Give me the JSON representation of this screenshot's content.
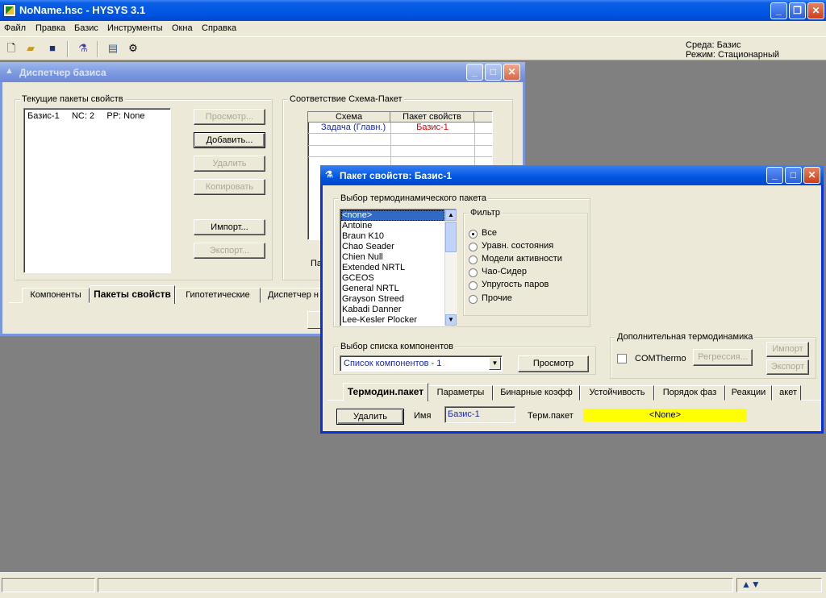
{
  "app": {
    "title": "NoName.hsc - HYSYS 3.1"
  },
  "menu": [
    "Файл",
    "Правка",
    "Базис",
    "Инструменты",
    "Окна",
    "Справка"
  ],
  "toolbar": {
    "icons": [
      "new-file-icon",
      "open-folder-icon",
      "save-icon",
      "flask-icon",
      "steam-table-icon",
      "component-icon"
    ],
    "env_line1": "Среда: Базис",
    "env_line2": "Режим: Стационарный"
  },
  "basis_manager": {
    "title": "Диспетчер базиса",
    "current_group": "Текущие пакеты свойств",
    "current_list": [
      "Базис-1     NC: 2     PP: None"
    ],
    "buttons": {
      "view": "Просмотр...",
      "add": "Добавить...",
      "delete": "Удалить",
      "copy": "Копировать",
      "import": "Импорт...",
      "export": "Экспорт..."
    },
    "mapping_group": "Соответствие Схема-Пакет",
    "mapping_headers": [
      "Схема",
      "Пакет свойств"
    ],
    "mapping_rows": [
      {
        "scheme": "Задача (Главн.)",
        "package": "Базис-1"
      }
    ],
    "peek_label": "Па",
    "tabs": [
      "Компоненты",
      "Пакеты свойств",
      "Гипотетические",
      "Диспетчер н"
    ]
  },
  "property_package": {
    "title": "Пакет свойств: Базис-1",
    "thermo_group": "Выбор термодинамического пакета",
    "thermo_list": [
      "<none>",
      "Antoine",
      "Braun K10",
      "Chao Seader",
      "Chien Null",
      "Extended NRTL",
      "GCEOS",
      "General NRTL",
      "Grayson Streed",
      "Kabadi Danner",
      "Lee-Kesler Plocker"
    ],
    "filter_group": "Фильтр",
    "filter_options": [
      "Все",
      "Уравн. состояния",
      "Модели активности",
      "Чао-Сидер",
      "Упругость паров",
      "Прочие"
    ],
    "component_group": "Выбор списка компонентов",
    "component_list_value": "Список компонентов - 1",
    "view_button": "Просмотр",
    "extra_group": "Дополнительная термодинамика",
    "comthermo_label": "COMThermo",
    "regression_button": "Регрессия...",
    "import_button": "Импорт",
    "export_button": "Экспорт",
    "tabs": [
      "Термодин.пакет",
      "Параметры",
      "Бинарные коэфф",
      "Устойчивость",
      "Порядок фаз",
      "Реакции",
      "акет"
    ],
    "delete_button": "Удалить",
    "name_label": "Имя",
    "name_value": "Базис-1",
    "thermo_label": "Терм.пакет",
    "thermo_value": "<None>"
  },
  "colors": {
    "titlebar": "#0054e3",
    "window_bg": "#ece9d8",
    "desktop": "#808080",
    "highlight": "#316ac5",
    "thermo_value_bg": "#ffff00"
  }
}
